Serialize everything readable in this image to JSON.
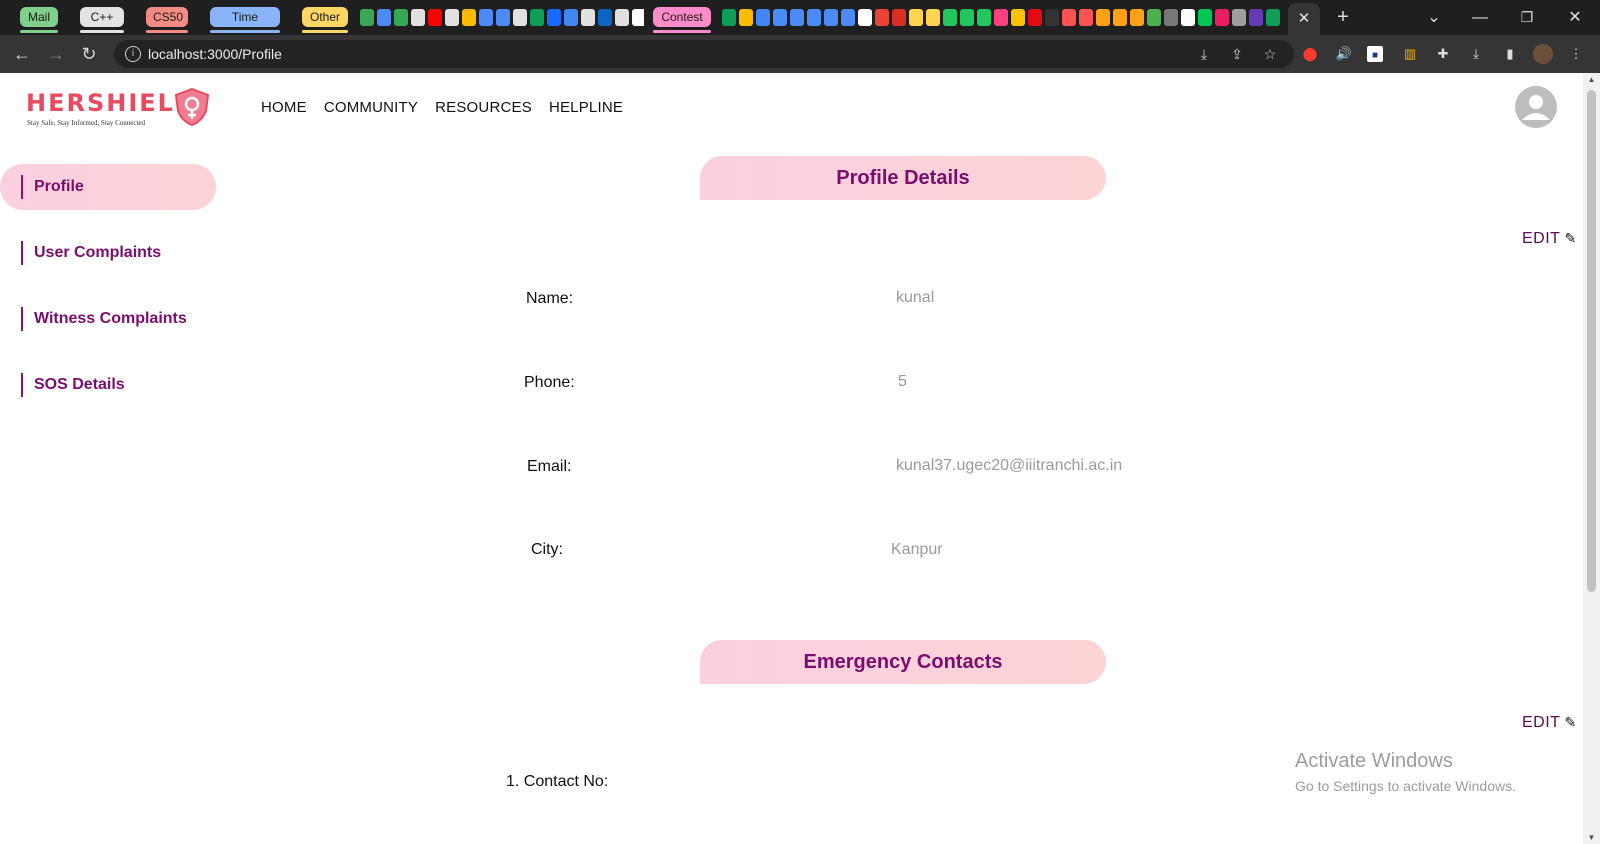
{
  "browser": {
    "tab_groups": [
      {
        "label": "Mail",
        "color": "#7ed08a"
      },
      {
        "label": "C++",
        "color": "#e3e3e3"
      },
      {
        "label": "CS50",
        "color": "#f28b82"
      },
      {
        "label": "Time Pass",
        "color": "#8ab4f8"
      },
      {
        "label": "Other",
        "color": "#fdd663"
      },
      {
        "label": "Contest",
        "color": "#ff8bcb"
      }
    ],
    "new_tab": "+",
    "close_tab": "✕",
    "url": "localhost:3000/Profile",
    "accent": "#353535"
  },
  "header": {
    "logo_text": "HERSHIELD",
    "logo_tagline": "Stay Safe, Stay Informed, Stay Connected",
    "nav": [
      "HOME",
      "COMMUNITY",
      "RESOURCES",
      "HELPLINE"
    ]
  },
  "sidebar": {
    "items": [
      {
        "label": "Profile",
        "active": true
      },
      {
        "label": "User Complaints",
        "active": false
      },
      {
        "label": "Witness Complaints",
        "active": false
      },
      {
        "label": "SOS Details",
        "active": false
      }
    ]
  },
  "profile": {
    "title": "Profile Details",
    "edit_label": "EDIT",
    "fields": [
      {
        "label": "Name:",
        "value": "kunal"
      },
      {
        "label": "Phone:",
        "value": "5"
      },
      {
        "label": "Email:",
        "value": "kunal37.ugec20@iiitranchi.ac.in"
      },
      {
        "label": "City:",
        "value": "Kanpur"
      }
    ]
  },
  "emergency": {
    "title": "Emergency Contacts",
    "edit_label": "EDIT",
    "contact_label": "1. Contact No:"
  },
  "watermark": {
    "line1": "Activate Windows",
    "line2": "Go to Settings to activate Windows."
  },
  "colors": {
    "brand": "#e84a5f",
    "accent_purple": "#7a0d6e",
    "pill_pink": "#fbcfe0"
  }
}
